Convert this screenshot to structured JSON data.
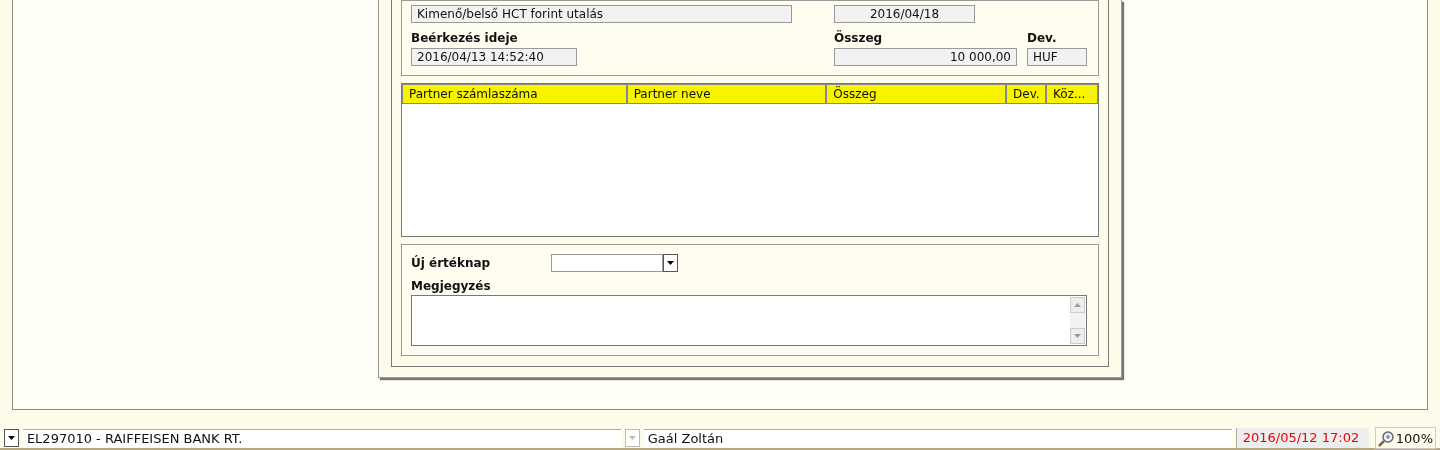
{
  "form": {
    "type_value": "Kimenő/belső HCT forint utalás",
    "date_value": "2016/04/18",
    "arrival_label": "Beérkezés ideje",
    "arrival_value": "2016/04/13 14:52:40",
    "amount_label": "Összeg",
    "amount_value": "10 000,00",
    "currency_label": "Dev.",
    "currency_value": "HUF"
  },
  "table": {
    "columns": [
      "Partner számlaszáma",
      "Partner neve",
      "Összeg",
      "Dev.",
      "Köz..."
    ]
  },
  "edit": {
    "new_date_label": "Új értéknap",
    "note_label": "Megjegyzés"
  },
  "status_bar": {
    "bank": "EL297010 - RAIFFEISEN BANK RT.",
    "user": "Gaál Zoltán",
    "datetime": "2016/05/12 17:02",
    "zoom": "100%"
  }
}
